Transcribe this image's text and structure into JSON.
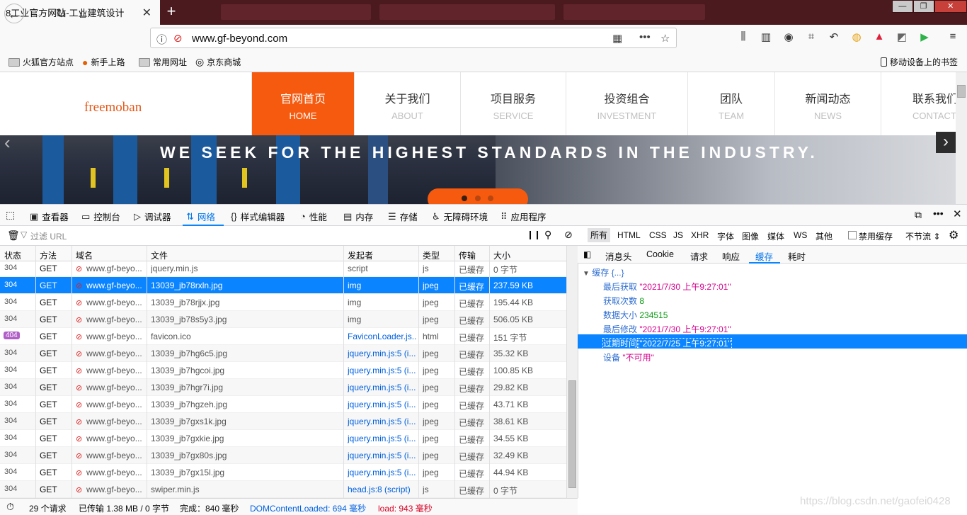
{
  "browser": {
    "tab_title": "8工业官方网站-工业建筑设计",
    "tab_close": "✕",
    "new_tab": "+",
    "url": "www.gf-beyond.com",
    "url_menu": "•••",
    "bookmarks": [
      "火狐官方站点",
      "新手上路",
      "常用网址",
      "京东商城"
    ],
    "mobile_bookmarks": "移动设备上的书签"
  },
  "site": {
    "logo": "freemoban",
    "nav": [
      {
        "cn": "官网首页",
        "en": "HOME"
      },
      {
        "cn": "关于我们",
        "en": "ABOUT"
      },
      {
        "cn": "项目服务",
        "en": "SERVICE"
      },
      {
        "cn": "投资组合",
        "en": "INVESTMENT"
      },
      {
        "cn": "团队",
        "en": "TEAM"
      },
      {
        "cn": "新闻动态",
        "en": "NEWS"
      },
      {
        "cn": "联系我们",
        "en": "CONTACT"
      }
    ],
    "slogan": "WE SEEK FOR THE HIGHEST STANDARDS IN THE INDUSTRY."
  },
  "devtools": {
    "tabs": [
      "查看器",
      "控制台",
      "调试器",
      "网络",
      "样式编辑器",
      "性能",
      "内存",
      "存储",
      "无障碍环境",
      "应用程序"
    ],
    "filter_placeholder": "过滤 URL",
    "types": [
      "所有",
      "HTML",
      "CSS",
      "JS",
      "XHR",
      "字体",
      "图像",
      "媒体",
      "WS",
      "其他"
    ],
    "disable_cache": "禁用缓存",
    "throttle": "不节流 ⇕",
    "columns": [
      "状态",
      "方法",
      "域名",
      "文件",
      "发起者",
      "类型",
      "传输",
      "大小"
    ],
    "rows": [
      {
        "status": "304",
        "method": "GET",
        "domain": "www.gf-beyo...",
        "file": "jquery.min.js",
        "cause": "script",
        "type": "js",
        "transfer": "已缓存",
        "size": "0 字节"
      },
      {
        "status": "304",
        "method": "GET",
        "domain": "www.gf-beyo...",
        "file": "13039_jb78rxln.jpg",
        "cause": "img",
        "type": "jpeg",
        "transfer": "已缓存",
        "size": "237.59 KB"
      },
      {
        "status": "304",
        "method": "GET",
        "domain": "www.gf-beyo...",
        "file": "13039_jb78rjjx.jpg",
        "cause": "img",
        "type": "jpeg",
        "transfer": "已缓存",
        "size": "195.44 KB"
      },
      {
        "status": "304",
        "method": "GET",
        "domain": "www.gf-beyo...",
        "file": "13039_jb78s5y3.jpg",
        "cause": "img",
        "type": "jpeg",
        "transfer": "已缓存",
        "size": "506.05 KB"
      },
      {
        "status": "404",
        "method": "GET",
        "domain": "www.gf-beyo...",
        "file": "favicon.ico",
        "cause": "FaviconLoader.js...",
        "type": "html",
        "transfer": "已缓存",
        "size": "151 字节"
      },
      {
        "status": "304",
        "method": "GET",
        "domain": "www.gf-beyo...",
        "file": "13039_jb7hg6c5.jpg",
        "cause": "jquery.min.js:5 (i...",
        "type": "jpeg",
        "transfer": "已缓存",
        "size": "35.32 KB"
      },
      {
        "status": "304",
        "method": "GET",
        "domain": "www.gf-beyo...",
        "file": "13039_jb7hgcoi.jpg",
        "cause": "jquery.min.js:5 (i...",
        "type": "jpeg",
        "transfer": "已缓存",
        "size": "100.85 KB"
      },
      {
        "status": "304",
        "method": "GET",
        "domain": "www.gf-beyo...",
        "file": "13039_jb7hgr7i.jpg",
        "cause": "jquery.min.js:5 (i...",
        "type": "jpeg",
        "transfer": "已缓存",
        "size": "29.82 KB"
      },
      {
        "status": "304",
        "method": "GET",
        "domain": "www.gf-beyo...",
        "file": "13039_jb7hgzeh.jpg",
        "cause": "jquery.min.js:5 (i...",
        "type": "jpeg",
        "transfer": "已缓存",
        "size": "43.71 KB"
      },
      {
        "status": "304",
        "method": "GET",
        "domain": "www.gf-beyo...",
        "file": "13039_jb7gxs1k.jpg",
        "cause": "jquery.min.js:5 (i...",
        "type": "jpeg",
        "transfer": "已缓存",
        "size": "38.61 KB"
      },
      {
        "status": "304",
        "method": "GET",
        "domain": "www.gf-beyo...",
        "file": "13039_jb7gxkie.jpg",
        "cause": "jquery.min.js:5 (i...",
        "type": "jpeg",
        "transfer": "已缓存",
        "size": "34.55 KB"
      },
      {
        "status": "304",
        "method": "GET",
        "domain": "www.gf-beyo...",
        "file": "13039_jb7gx80s.jpg",
        "cause": "jquery.min.js:5 (i...",
        "type": "jpeg",
        "transfer": "已缓存",
        "size": "32.49 KB"
      },
      {
        "status": "304",
        "method": "GET",
        "domain": "www.gf-beyo...",
        "file": "13039_jb7gx15l.jpg",
        "cause": "jquery.min.js:5 (i...",
        "type": "jpeg",
        "transfer": "已缓存",
        "size": "44.94 KB"
      },
      {
        "status": "304",
        "method": "GET",
        "domain": "www.gf-beyo...",
        "file": "swiper.min.js",
        "cause": "head.js:8 (script)",
        "type": "js",
        "transfer": "已缓存",
        "size": "0 字节"
      }
    ],
    "side_tabs": [
      "消息头",
      "Cookie",
      "请求",
      "响应",
      "缓存",
      "耗时"
    ],
    "cache": {
      "root": "缓存 {...}",
      "items": [
        {
          "key": "最后获取",
          "value": "\"2021/7/30 上午9:27:01\""
        },
        {
          "key": "获取次数",
          "value": "8"
        },
        {
          "key": "数据大小",
          "value": "234515"
        },
        {
          "key": "最后修改",
          "value": "\"2021/7/30 上午9:27:01\""
        },
        {
          "key": "过期时间",
          "value": "\"2022/7/25 上午9:27:01\""
        },
        {
          "key": "设备",
          "value": "\"不可用\""
        }
      ]
    },
    "status": {
      "requests": "29 个请求",
      "transferred": "已传输 1.38 MB / 0 字节",
      "finish": "完成：840 毫秒",
      "dcl": "DOMContentLoaded: 694 毫秒",
      "load": "load: 943 毫秒"
    }
  },
  "watermark": "https://blog.csdn.net/gaofei0428"
}
